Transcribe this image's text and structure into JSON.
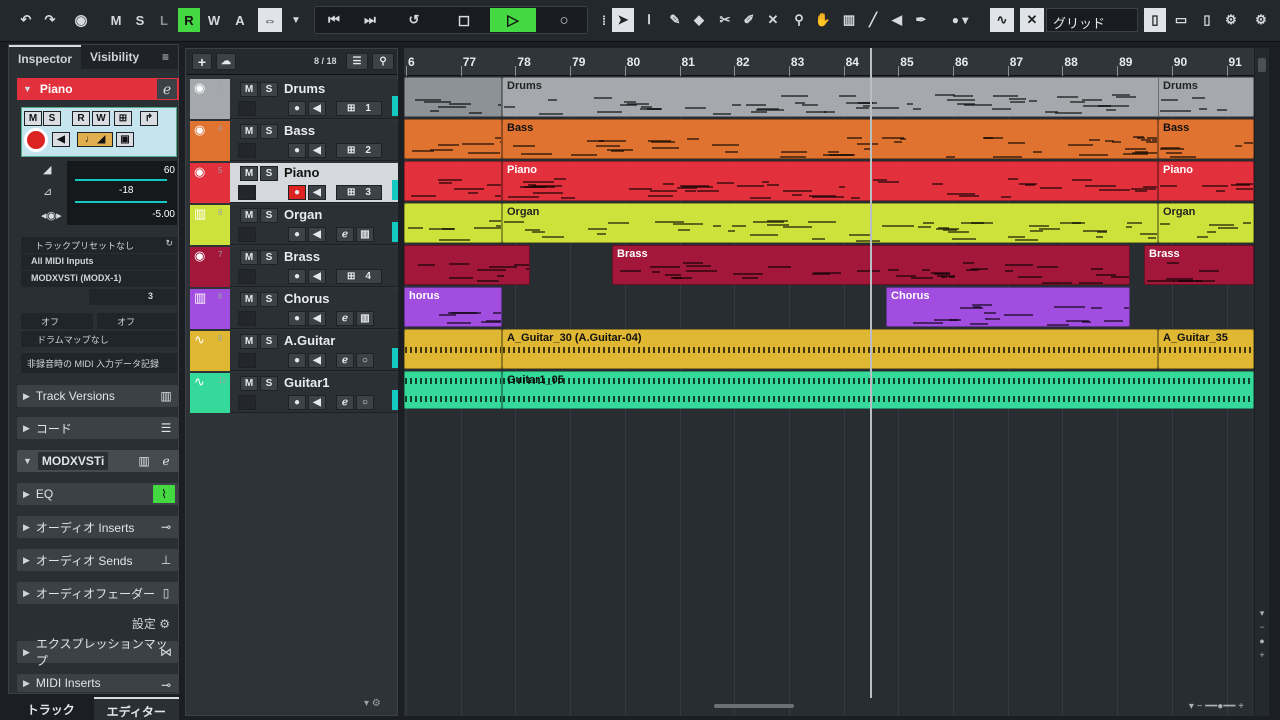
{
  "toolbar": {
    "mode_buttons": [
      "M",
      "S",
      "L",
      "R",
      "W",
      "A"
    ],
    "grid_label": "グリッド"
  },
  "inspector": {
    "tabs": [
      "Inspector",
      "Visibility"
    ],
    "track_name": "Piano",
    "volume": "60",
    "pan": "-18",
    "delay": "-5.00",
    "preset": "トラックプリセットなし",
    "midi_input": "All MIDI Inputs",
    "midi_output": "MODXVSTi (MODX-1)",
    "channel": "3",
    "bank": "オフ",
    "program": "オフ",
    "drum_map": "ドラムマップなし",
    "record_mode": "非録音時の MIDI 入力データ記録",
    "sections": [
      "Track Versions",
      "コード",
      "MODXVSTi",
      "EQ",
      "オーディオ Inserts",
      "オーディオ Sends",
      "オーディオフェーダー"
    ],
    "settings_label": "設定",
    "more_sections": [
      "エクスプレッションマップ",
      "MIDI Inserts"
    ],
    "bottom_tabs": [
      "トラック",
      "エディター"
    ]
  },
  "tracklist": {
    "count": "8 / 18",
    "tracks": [
      {
        "num": "3",
        "name": "Drums",
        "ch": "1",
        "color": "#a5a9ad"
      },
      {
        "num": "4",
        "name": "Bass",
        "ch": "2",
        "color": "#e0732f"
      },
      {
        "num": "5",
        "name": "Piano",
        "ch": "3",
        "color": "#e2303d"
      },
      {
        "num": "6",
        "name": "Organ",
        "ch": "",
        "color": "#cfe23b"
      },
      {
        "num": "7",
        "name": "Brass",
        "ch": "4",
        "color": "#a3173a"
      },
      {
        "num": "8",
        "name": "Chorus",
        "ch": "",
        "color": "#a04de0"
      },
      {
        "num": "9",
        "name": "A.Guitar",
        "ch": "",
        "color": "#e0b733"
      },
      {
        "num": "11",
        "name": "Guitar1",
        "ch": "",
        "color": "#35d99a"
      }
    ]
  },
  "ruler": {
    "bars": [
      "6",
      "77",
      "78",
      "79",
      "80",
      "81",
      "82",
      "83",
      "84",
      "85",
      "86",
      "87",
      "88",
      "89",
      "90",
      "91"
    ]
  },
  "parts": {
    "drums": "Drums",
    "bass": "Bass",
    "piano": "Piano",
    "organ": "Organ",
    "brass": "Brass",
    "chorus_a": "horus",
    "chorus_b": "Chorus",
    "aguitar_a": "A_Guitar_30 (A.Guitar-04)",
    "aguitar_b": "A_Guitar_35",
    "guitar1": "Guitar1_05"
  }
}
